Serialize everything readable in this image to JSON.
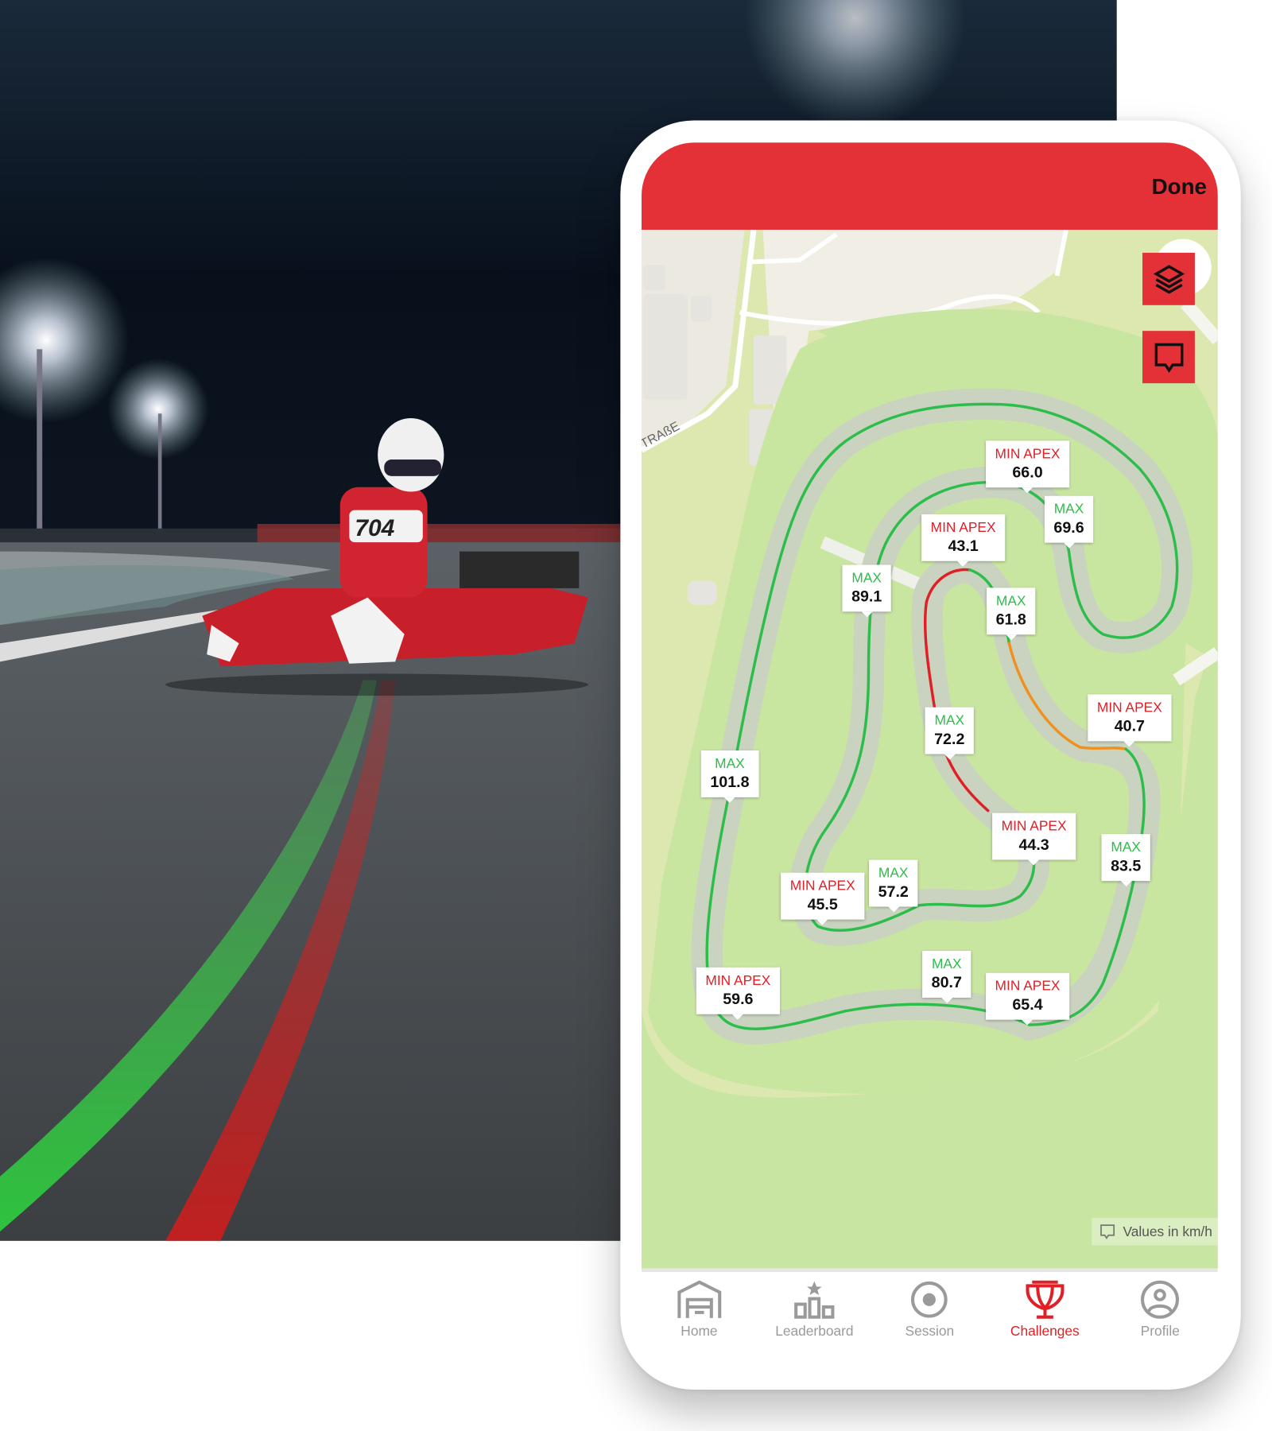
{
  "header": {
    "done_label": "Done"
  },
  "map": {
    "street_label": "TRAßE",
    "units_note": "Values in km/h",
    "labels": [
      {
        "type": "min",
        "title": "MIN APEX",
        "value": "66.0"
      },
      {
        "type": "max",
        "title": "MAX",
        "value": "69.6"
      },
      {
        "type": "min",
        "title": "MIN APEX",
        "value": "43.1"
      },
      {
        "type": "max",
        "title": "MAX",
        "value": "89.1"
      },
      {
        "type": "max",
        "title": "MAX",
        "value": "61.8"
      },
      {
        "type": "min",
        "title": "MIN APEX",
        "value": "40.7"
      },
      {
        "type": "max",
        "title": "MAX",
        "value": "72.2"
      },
      {
        "type": "max",
        "title": "MAX",
        "value": "101.8"
      },
      {
        "type": "min",
        "title": "MIN APEX",
        "value": "44.3"
      },
      {
        "type": "max",
        "title": "MAX",
        "value": "83.5"
      },
      {
        "type": "max",
        "title": "MAX",
        "value": "57.2"
      },
      {
        "type": "min",
        "title": "MIN APEX",
        "value": "45.5"
      },
      {
        "type": "max",
        "title": "MAX",
        "value": "80.7"
      },
      {
        "type": "min",
        "title": "MIN APEX",
        "value": "59.6"
      },
      {
        "type": "min",
        "title": "MIN APEX",
        "value": "65.4"
      }
    ]
  },
  "photo": {
    "kart_number": "704"
  },
  "nav": {
    "items": [
      {
        "label": "Home",
        "icon": "garage-icon",
        "active": false
      },
      {
        "label": "Leaderboard",
        "icon": "podium-icon",
        "active": false
      },
      {
        "label": "Session",
        "icon": "record-icon",
        "active": false
      },
      {
        "label": "Challenges",
        "icon": "trophy-icon",
        "active": true
      },
      {
        "label": "Profile",
        "icon": "profile-icon",
        "active": false
      }
    ]
  },
  "colors": {
    "brand": "#e43138",
    "max": "#2dbd4a",
    "min": "#e02027",
    "track_orange": "#f0901e"
  }
}
